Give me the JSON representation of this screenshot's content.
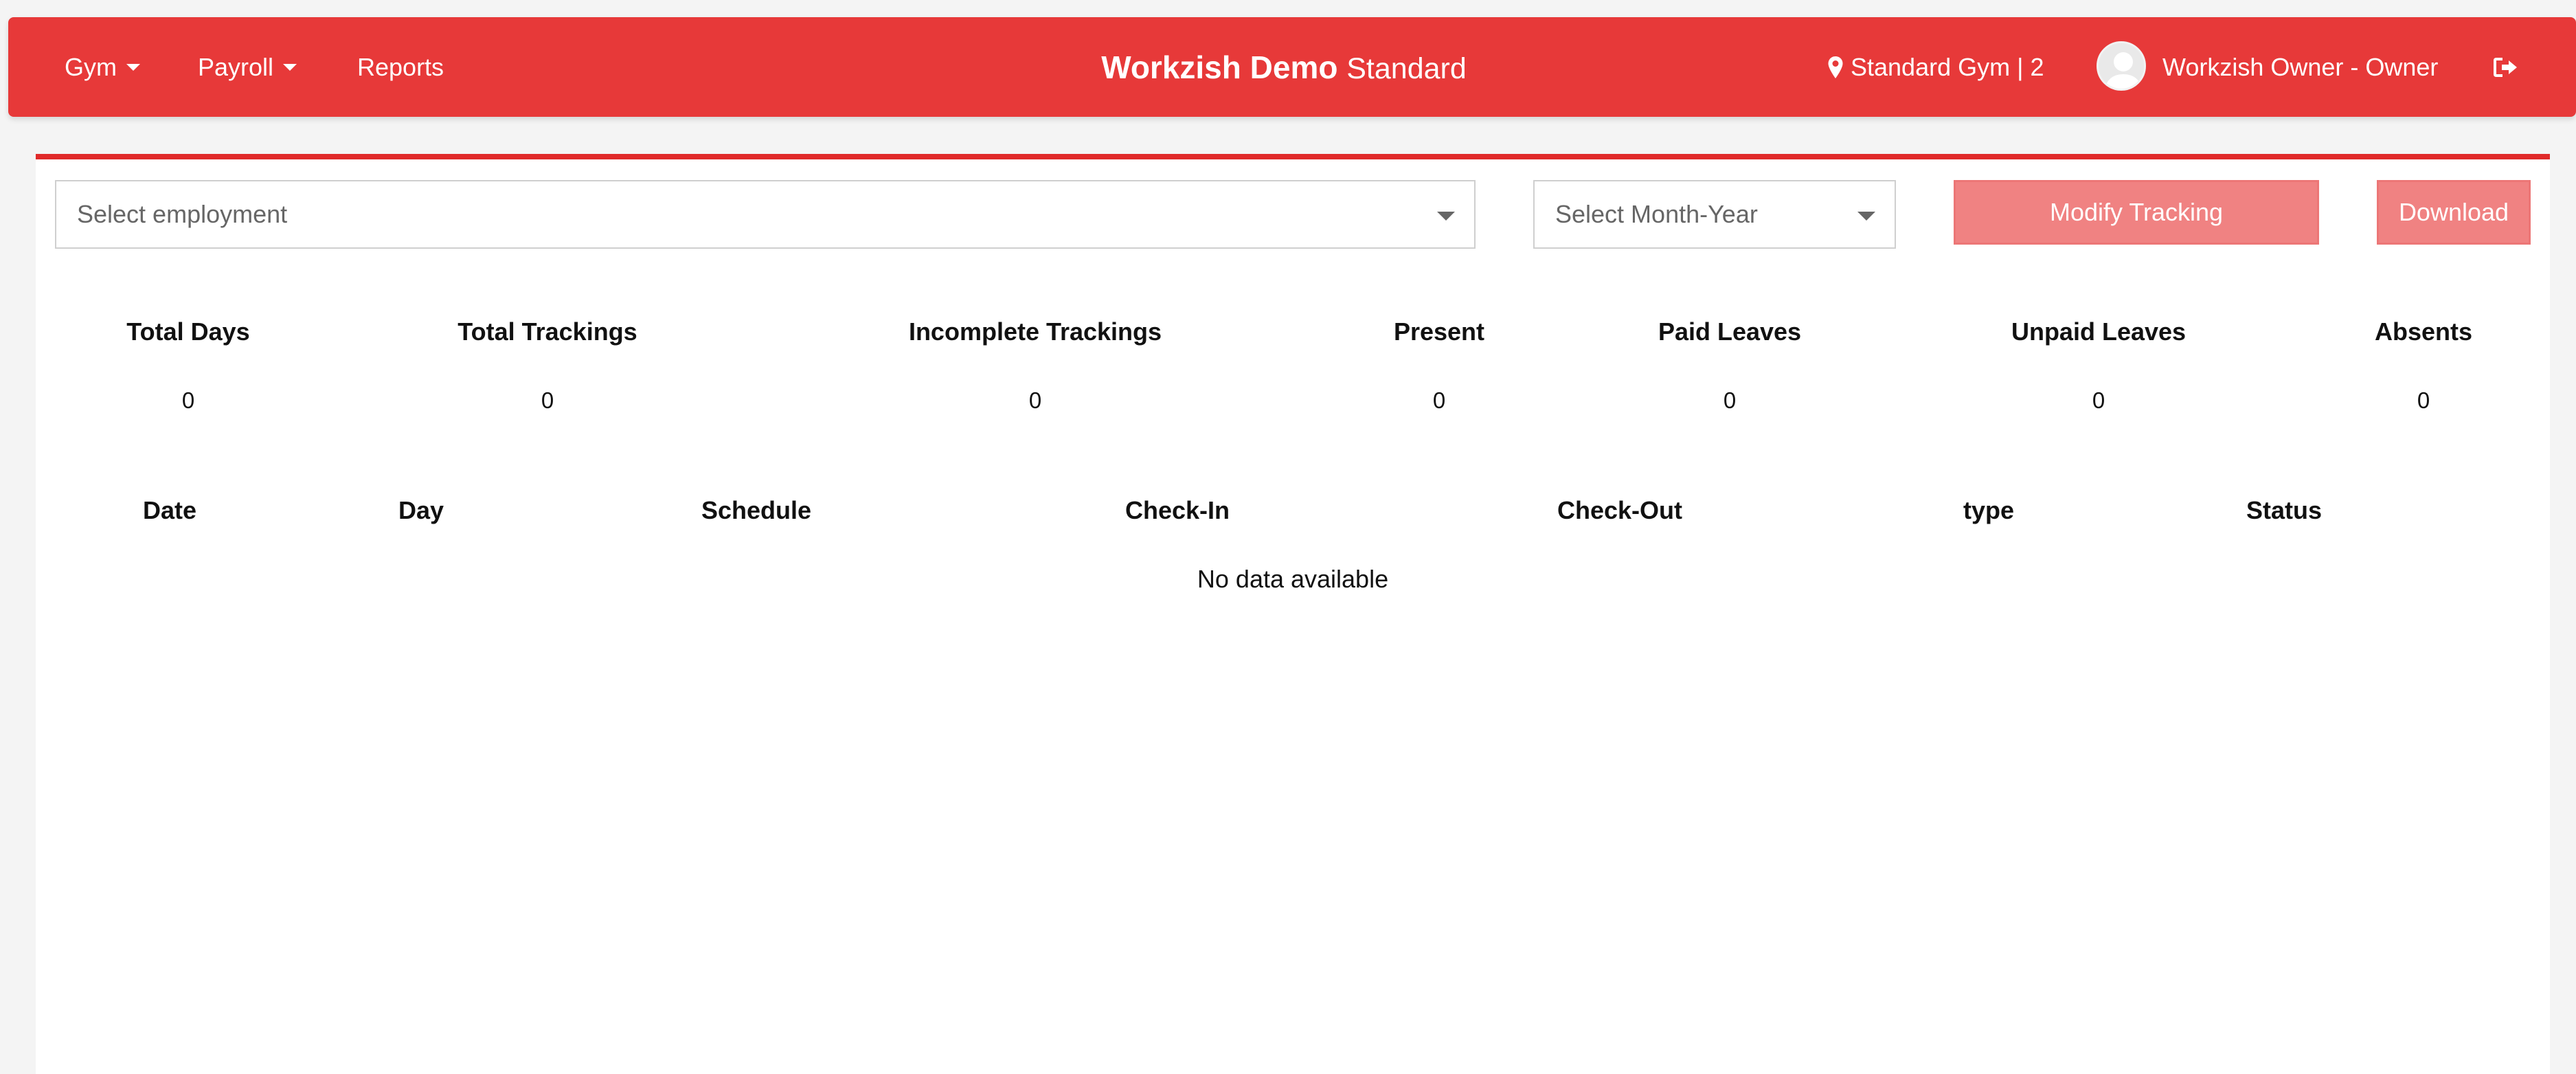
{
  "nav": {
    "gym": "Gym",
    "payroll": "Payroll",
    "reports": "Reports",
    "brand_name": "Workzish Demo",
    "brand_plan": "Standard",
    "location": "Standard Gym | 2",
    "user": "Workzish Owner - Owner"
  },
  "filters": {
    "employment_placeholder": "Select employment",
    "month_placeholder": "Select Month-Year",
    "modify_label": "Modify Tracking",
    "download_label": "Download"
  },
  "stats": [
    {
      "label": "Total Days",
      "value": "0"
    },
    {
      "label": "Total Trackings",
      "value": "0"
    },
    {
      "label": "Incomplete Trackings",
      "value": "0"
    },
    {
      "label": "Present",
      "value": "0"
    },
    {
      "label": "Paid Leaves",
      "value": "0"
    },
    {
      "label": "Unpaid Leaves",
      "value": "0"
    },
    {
      "label": "Absents",
      "value": "0"
    }
  ],
  "table": {
    "columns": [
      "Date",
      "Day",
      "Schedule",
      "Check-In",
      "Check-Out",
      "type",
      "Status"
    ],
    "empty_message": "No data available"
  },
  "icons": {
    "location": "map-marker-icon",
    "logout": "sign-out-icon",
    "avatar": "user-avatar"
  },
  "colors": {
    "navbar": "#e73939",
    "accent_line": "#e02a2a",
    "button": "#f08282"
  }
}
